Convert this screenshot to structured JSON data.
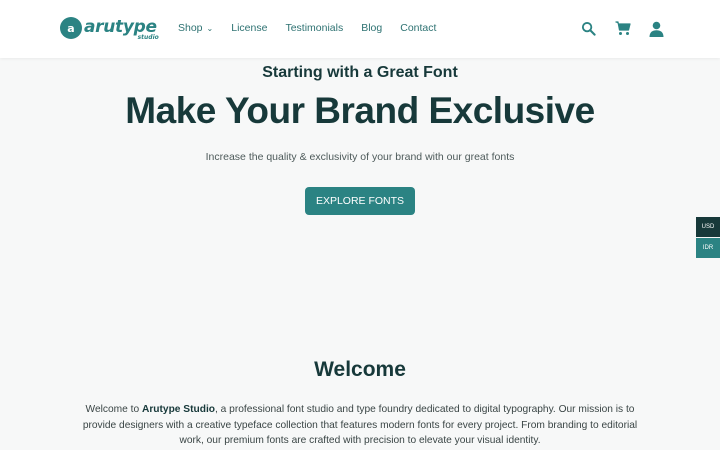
{
  "header": {
    "logo_text": "arutype",
    "logo_sub": "studio",
    "nav": [
      {
        "label": "Shop",
        "has_dropdown": true
      },
      {
        "label": "License"
      },
      {
        "label": "Testimonials"
      },
      {
        "label": "Blog"
      },
      {
        "label": "Contact"
      }
    ],
    "icons": [
      "search-icon",
      "cart-icon",
      "user-icon"
    ]
  },
  "hero": {
    "subtitle": "Starting with a Great Font",
    "headline": "Make Your Brand Exclusive",
    "tagline": "Increase the quality & exclusivity of your brand with our great fonts",
    "cta": "EXPLORE FONTS"
  },
  "currency": {
    "options": [
      "USD",
      "IDR"
    ],
    "selected": "USD"
  },
  "welcome": {
    "title": "Welcome",
    "body_prefix": "Welcome to ",
    "body_strong": "Arutype Studio",
    "body_rest": ", a professional font studio and type foundry dedicated to digital typography. Our mission is to provide designers with a creative typeface collection that features modern fonts for every project. From branding to editorial work, our premium fonts are crafted with precision to elevate your visual identity."
  },
  "colors": {
    "brand": "#2b8383",
    "dark": "#17393a",
    "background": "#f7f8f8"
  }
}
